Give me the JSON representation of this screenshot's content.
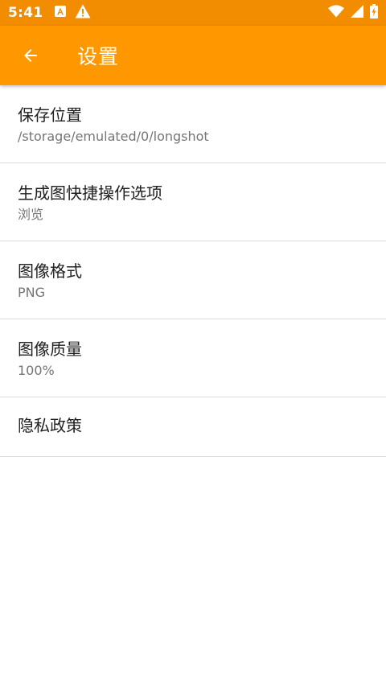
{
  "status_bar": {
    "time": "5:41",
    "icons": [
      "a-badge-icon",
      "warning-icon",
      "wifi-icon",
      "signal-icon",
      "battery-icon"
    ]
  },
  "app_bar": {
    "title": "设置",
    "back_icon": "arrow-back-icon"
  },
  "colors": {
    "status_bar": "#f28c00",
    "app_bar": "#ff9800",
    "title_text": "#212121",
    "sub_text": "#757575",
    "divider": "#dcdcdc"
  },
  "settings": {
    "items": [
      {
        "title": "保存位置",
        "value": "/storage/emulated/0/longshot"
      },
      {
        "title": "生成图快捷操作选项",
        "value": "浏览"
      },
      {
        "title": "图像格式",
        "value": "PNG"
      },
      {
        "title": "图像质量",
        "value": "100%"
      },
      {
        "title": "隐私政策"
      }
    ]
  }
}
